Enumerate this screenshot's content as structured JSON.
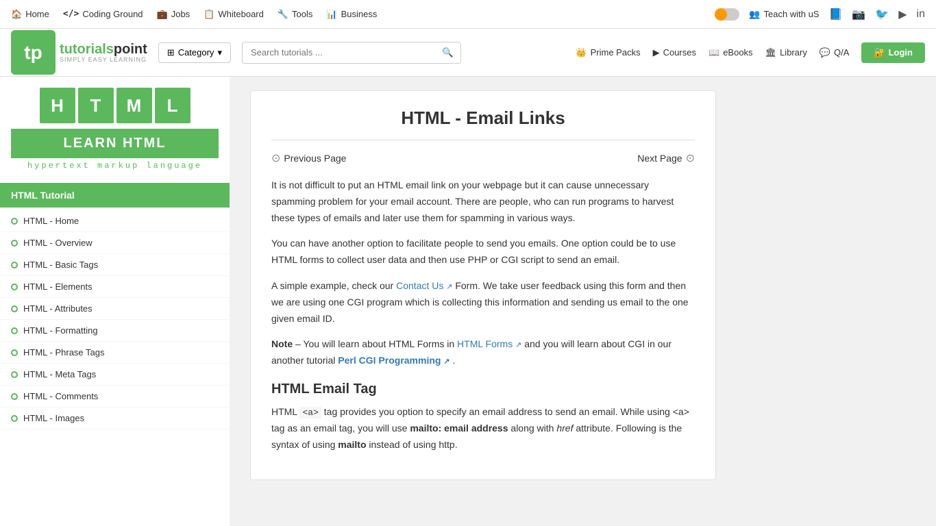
{
  "topnav": {
    "items": [
      {
        "label": "Home",
        "icon": "🏠"
      },
      {
        "label": "Coding Ground",
        "icon": "</>"
      },
      {
        "label": "Jobs",
        "icon": "💼"
      },
      {
        "label": "Whiteboard",
        "icon": "📋"
      },
      {
        "label": "Tools",
        "icon": "🔧"
      },
      {
        "label": "Business",
        "icon": "📊"
      }
    ],
    "teach_label": "Teach with uS",
    "teach_icon": "👥"
  },
  "header": {
    "logo_text_1": "tutorials",
    "logo_text_2": "point",
    "tagline": "SIMPLY EASY LEARNING",
    "category_label": "Category",
    "search_placeholder": "Search tutorials ...",
    "nav_links": [
      {
        "label": "Prime Packs",
        "icon": "👑"
      },
      {
        "label": "Courses",
        "icon": "▶"
      },
      {
        "label": "eBooks",
        "icon": "📖"
      },
      {
        "label": "Library",
        "icon": "🏛"
      },
      {
        "label": "Q/A",
        "icon": "💬"
      }
    ],
    "login_label": "Login"
  },
  "sidebar": {
    "html_letters": [
      "H",
      "T",
      "M",
      "L"
    ],
    "learn_label": "LEARN HTML",
    "hypertext_label": "hypertext markup language",
    "tutorial_title": "HTML Tutorial",
    "items": [
      "HTML - Home",
      "HTML - Overview",
      "HTML - Basic Tags",
      "HTML - Elements",
      "HTML - Attributes",
      "HTML - Formatting",
      "HTML - Phrase Tags",
      "HTML - Meta Tags",
      "HTML - Comments",
      "HTML - Images"
    ]
  },
  "content": {
    "page_title": "HTML - Email Links",
    "prev_label": "Previous Page",
    "next_label": "Next Page",
    "para1": "It is not difficult to put an HTML email link on your webpage but it can cause unnecessary spamming problem for your email account. There are people, who can run programs to harvest these types of emails and later use them for spamming in various ways.",
    "para2": "You can have another option to facilitate people to send you emails. One option could be to use HTML forms to collect user data and then use PHP or CGI script to send an email.",
    "para3_prefix": "A simple example, check our ",
    "contact_us_link": "Contact Us",
    "para3_suffix": " Form. We take user feedback using this form and then we are using one CGI program which is collecting this information and sending us email to the one given email ID.",
    "note_prefix": "Note",
    "note_dash": " – You will learn about HTML Forms in ",
    "html_forms_link": "HTML Forms",
    "note_mid": " and you will learn about CGI in our another tutorial ",
    "perl_cgi_link": "Perl CGI Programming",
    "note_end": " .",
    "section_title": "HTML Email Tag",
    "para4_prefix": "HTML ",
    "para4_a_tag": "<a>",
    "para4_suffix": " tag provides you option to specify an email address to send an email. While using <a> tag as an email tag, you will use ",
    "mailto_text": "mailto: email address",
    "para4_end": " along with ",
    "href_text": "href",
    "para4_last": " attribute. Following is the syntax of using ",
    "mailto_text2": "mailto",
    "para4_final": " instead of using http."
  }
}
